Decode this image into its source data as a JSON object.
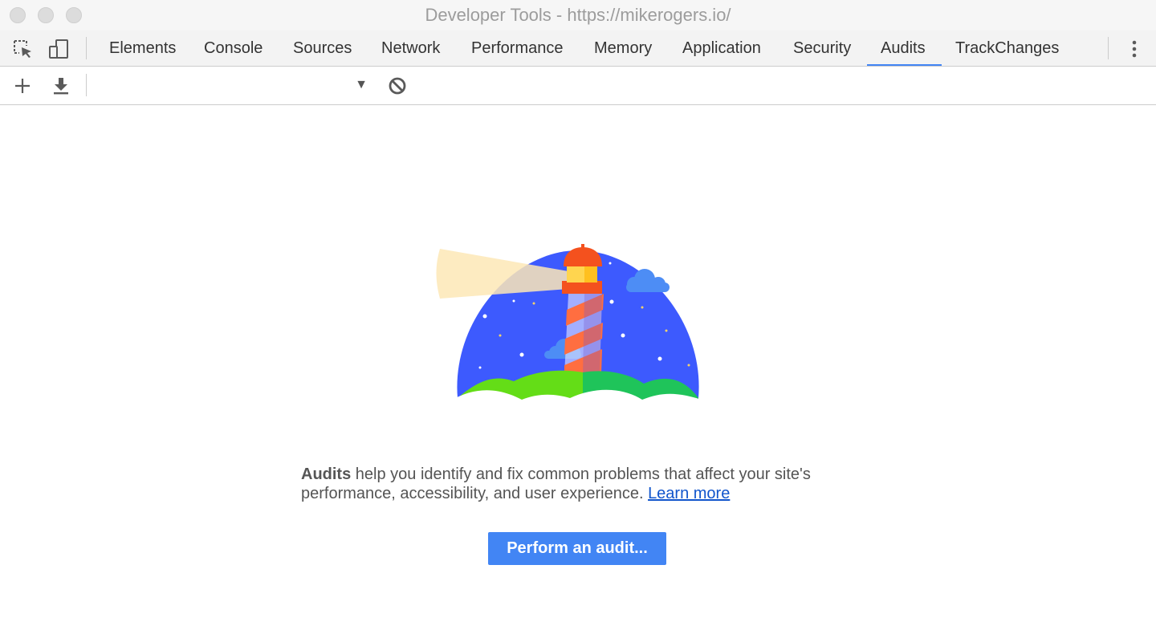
{
  "window": {
    "title": "Developer Tools - https://mikerogers.io/"
  },
  "tabs": [
    {
      "label": "Elements"
    },
    {
      "label": "Console"
    },
    {
      "label": "Sources"
    },
    {
      "label": "Network"
    },
    {
      "label": "Performance"
    },
    {
      "label": "Memory"
    },
    {
      "label": "Application"
    },
    {
      "label": "Security"
    },
    {
      "label": "Audits",
      "active": true
    },
    {
      "label": "TrackChanges"
    }
  ],
  "toolbar": {
    "icons": [
      "inspect-element-icon",
      "device-toolbar-icon",
      "add-icon",
      "download-icon",
      "clear-icon",
      "more-options-icon"
    ],
    "report_select_value": ""
  },
  "colors": {
    "accent": "#4285f4",
    "link": "#1155cc",
    "sky": "#3d5afe",
    "grass": "#3bd447"
  },
  "main": {
    "desc_bold": "Audits",
    "desc_text": " help you identify and fix common problems that affect your site's performance, accessibility, and user experience. ",
    "learn_more": "Learn more",
    "perform_button": "Perform an audit..."
  }
}
